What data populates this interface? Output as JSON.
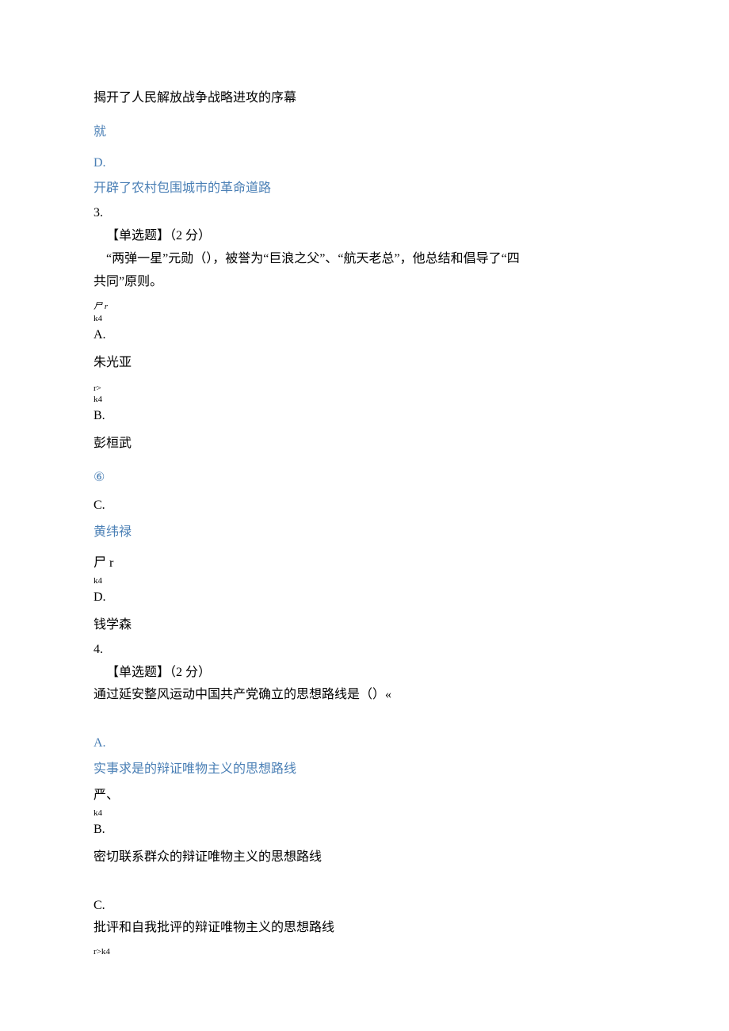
{
  "line_prev_option": "揭开了人民解放战争战略进攻的序幕",
  "blue_jiu": "就",
  "blue_d": "D.",
  "blue_d_text": "开辟了农村包围城市的革命道路",
  "q3": {
    "num": "3.",
    "type_label": "【单选题】（2 分）",
    "stem1": "“两弹一星”元勋（），被誉为“巨浪之父”、“航天老总”，他总结和倡导了“四",
    "stem2": "共同”原则。",
    "marker_a": "尸 r",
    "marker_a_sub": "k4",
    "a_label": "A.",
    "a_text": "朱光亚",
    "marker_b1": "r>",
    "marker_b2": "k4",
    "b_label": "B.",
    "b_text": "彭桓武",
    "marker_c": "⑥",
    "c_label": "C.",
    "c_text": "黄纬禄",
    "marker_d1": "尸 r",
    "marker_d2": "k4",
    "d_label": "D.",
    "d_text": "钱学森"
  },
  "q4": {
    "num": "4.",
    "type_label": "【单选题】（2 分）",
    "stem": "通过延安整风运动中国共产党确立的思想路线是（）«",
    "a_label": "A.",
    "a_text": "实事求是的辩证唯物主义的思想路线",
    "marker_b1": "严、",
    "marker_b2": "k4",
    "b_label": "B.",
    "b_text": "密切联系群众的辩证唯物主义的思想路线",
    "c_label": "C.",
    "c_text": "批评和自我批评的辩证唯物主义的思想路线",
    "marker_end": "r>k4"
  }
}
